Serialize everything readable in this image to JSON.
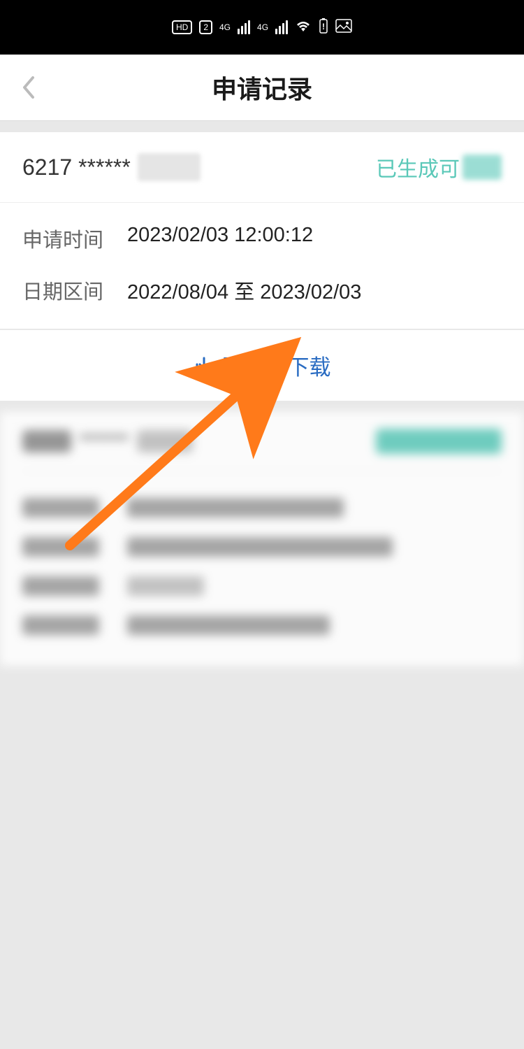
{
  "statusBar": {
    "hdLabel": "HD",
    "simLabel": "2",
    "signal1": "4G",
    "signal2": "4G"
  },
  "navbar": {
    "title": "申请记录"
  },
  "record": {
    "accountNumber": "6217 ******",
    "statusText": "已生成可",
    "applyTimeLabel": "申请时间",
    "applyTimeValue": "2023/02/03 12:00:12",
    "dateRangeLabel": "日期区间",
    "dateRangeValue": "2022/08/04 至 2023/02/03"
  },
  "action": {
    "downloadLabel": "预览并下载"
  }
}
